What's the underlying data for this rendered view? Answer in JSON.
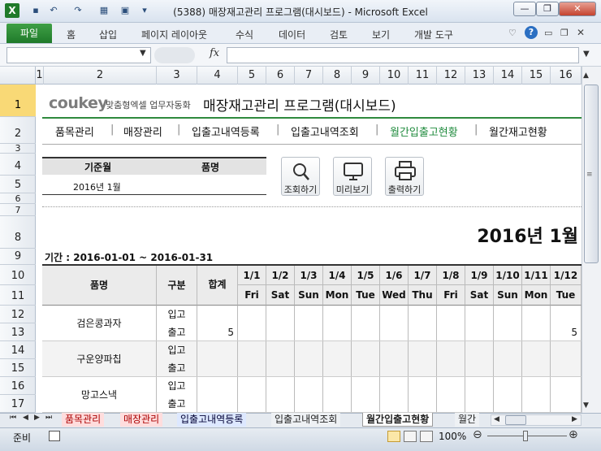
{
  "window": {
    "title": "(5388) 매장재고관리 프로그램(대시보드) - Microsoft Excel",
    "minimize": "—",
    "restore": "❐",
    "close": "✕"
  },
  "ribbon": {
    "file_tab": "파일",
    "tabs": [
      "홈",
      "삽입",
      "페이지 레이아웃",
      "수식",
      "데이터",
      "검토",
      "보기",
      "개발 도구"
    ]
  },
  "formula_bar": {
    "name_box": "",
    "fx": "fx",
    "value": ""
  },
  "columns": [
    "1",
    "2",
    "3",
    "4",
    "5",
    "6",
    "7",
    "8",
    "9",
    "10",
    "11",
    "12",
    "13",
    "14",
    "15",
    "16"
  ],
  "rows": [
    "1",
    "2",
    "3",
    "4",
    "5",
    "6",
    "7",
    "8",
    "9",
    "10",
    "11",
    "12",
    "13",
    "14",
    "15",
    "16",
    "17"
  ],
  "header": {
    "logo_brand": "coukey",
    "logo_tagline": "맞춤형엑셀 업무자동화",
    "program_title": "매장재고관리 프로그램(대시보드)"
  },
  "nav": [
    "품목관리",
    "매장관리",
    "입출고내역등록",
    "입출고내역조회",
    "월간입출고현황",
    "월간재고현황"
  ],
  "nav_separator": "|",
  "filter": {
    "month_label": "기준월",
    "item_label": "품명",
    "month_value": "2016년 1월",
    "item_value": ""
  },
  "buttons": [
    {
      "label": "조회하기",
      "icon": "search-icon"
    },
    {
      "label": "미리보기",
      "icon": "monitor-icon"
    },
    {
      "label": "출력하기",
      "icon": "printer-icon"
    }
  ],
  "report": {
    "big_month": "2016년 1월",
    "period": "기간 : 2016-01-01 ~ 2016-01-31"
  },
  "table": {
    "col_item": "품명",
    "col_type": "구분",
    "col_total": "합계",
    "dates": [
      "1/1",
      "1/2",
      "1/3",
      "1/4",
      "1/5",
      "1/6",
      "1/7",
      "1/8",
      "1/9",
      "1/10",
      "1/11",
      "1/12"
    ],
    "days": [
      "Fri",
      "Sat",
      "Sun",
      "Mon",
      "Tue",
      "Wed",
      "Thu",
      "Fri",
      "Sat",
      "Sun",
      "Mon",
      "Tue"
    ],
    "rows": [
      {
        "item": "검은콩과자",
        "in_label": "입고",
        "out_label": "출고",
        "in_total": "",
        "out_total": "5",
        "out_values": [
          "",
          "",
          "",
          "",
          "",
          "",
          "",
          "",
          "",
          "",
          "",
          "5"
        ]
      },
      {
        "item": "구운양파칩",
        "in_label": "입고",
        "out_label": "출고",
        "in_total": "",
        "out_total": "",
        "out_values": [
          "",
          "",
          "",
          "",
          "",
          "",
          "",
          "",
          "",
          "",
          "",
          ""
        ]
      },
      {
        "item": "망고스낵",
        "in_label": "입고",
        "out_label": "출고",
        "in_total": "",
        "out_total": "",
        "out_values": [
          "",
          "",
          "",
          "",
          "",
          "",
          "",
          "",
          "",
          "",
          "",
          ""
        ]
      }
    ]
  },
  "sheet_tabs": [
    "품목관리",
    "매장관리",
    "입출고내역등록",
    "입출고내역조회",
    "월간입출고현황",
    "월간"
  ],
  "status": {
    "ready": "준비",
    "zoom": "100%"
  },
  "colors": {
    "accent_green": "#1e8a3c",
    "excel_green": "#2a8a3a",
    "selected_row": "#f9d976"
  }
}
